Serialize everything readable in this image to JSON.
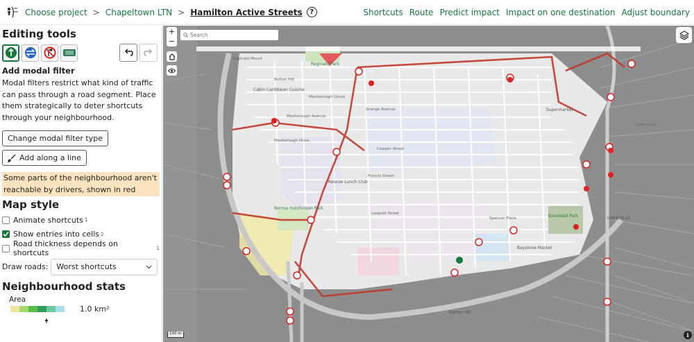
{
  "breadcrumb": {
    "choose_project": "Choose project",
    "separator": ">",
    "project": "Chapeltown LTN",
    "neighbourhood": "Hamilton Active Streets",
    "help_glyph": "?"
  },
  "nav": [
    "Shortcuts",
    "Route",
    "Predict impact",
    "Impact on one destination",
    "Adjust boundary"
  ],
  "sidebar": {
    "editing_title": "Editing tools",
    "tools": [
      "modal-filter-tool",
      "one-way-tool",
      "turn-restriction-tool",
      "traffic-signal-tool"
    ],
    "add_filter_title": "Add modal filter",
    "add_filter_desc": "Modal filters restrict what kind of traffic can pass through a road segment. Place them strategically to deter shortcuts through your neighbourhood.",
    "change_type_label": "Change modal filter type",
    "add_line_label": "Add along a line",
    "warning": "Some parts of the neighbourhood aren't reachable by drivers, shown in red",
    "map_style_title": "Map style",
    "animate_label": "Animate shortcuts",
    "animate_sup": "1",
    "entries_label": "Show entries into cells",
    "entries_sup": "2",
    "thickness_label": "Road thickness depends on shortcuts",
    "thickness_sup": "1",
    "draw_roads_label": "Draw roads:",
    "draw_roads_value": "Worst shortcuts",
    "stats_title": "Neighbourhood stats",
    "area_label": "Area",
    "area_value": "1.0 km²",
    "legend_colors": [
      "#f1e3a2",
      "#a7d86a",
      "#5bbd4c",
      "#2ea05a",
      "#6cc9a0",
      "#a8e0e6"
    ],
    "checkbox_states": {
      "animate": false,
      "entries": true,
      "thickness": false
    }
  },
  "map": {
    "search_placeholder": "Search",
    "zoom_in": "+",
    "zoom_out": "−",
    "scale": "100 m",
    "info": "i",
    "labels": {
      "reginald_park": "Reginald Park",
      "reginald_mount": "Reginald Mount",
      "button_hill": "Button Hill",
      "cabin_caribbean": "Cabin Caribbean Cuisine",
      "mexborough_grove": "Mexborough Grove",
      "mexborough_avenue": "Mexborough Avenue",
      "mexborough_drive": "Mexborough Drive",
      "grange_avenue": "Grange Avenue",
      "cowper_street": "Cowper Street",
      "francis_street": "Francis Street",
      "leopold_street": "Leopold Street",
      "roscoe_lunch_club": "Roscoe Lunch Club",
      "norma_hutchinson_park": "Norma Hutchinson Park",
      "spencer_place": "Spencer Place",
      "banstead_park": "Banstead Park",
      "harehills": "HAREHILLS",
      "baystone_market": "Baystone Market",
      "supermarket": "Supermarket",
      "luxor_road": "Luxor Road",
      "burton_hill": "Burton Hill"
    }
  }
}
